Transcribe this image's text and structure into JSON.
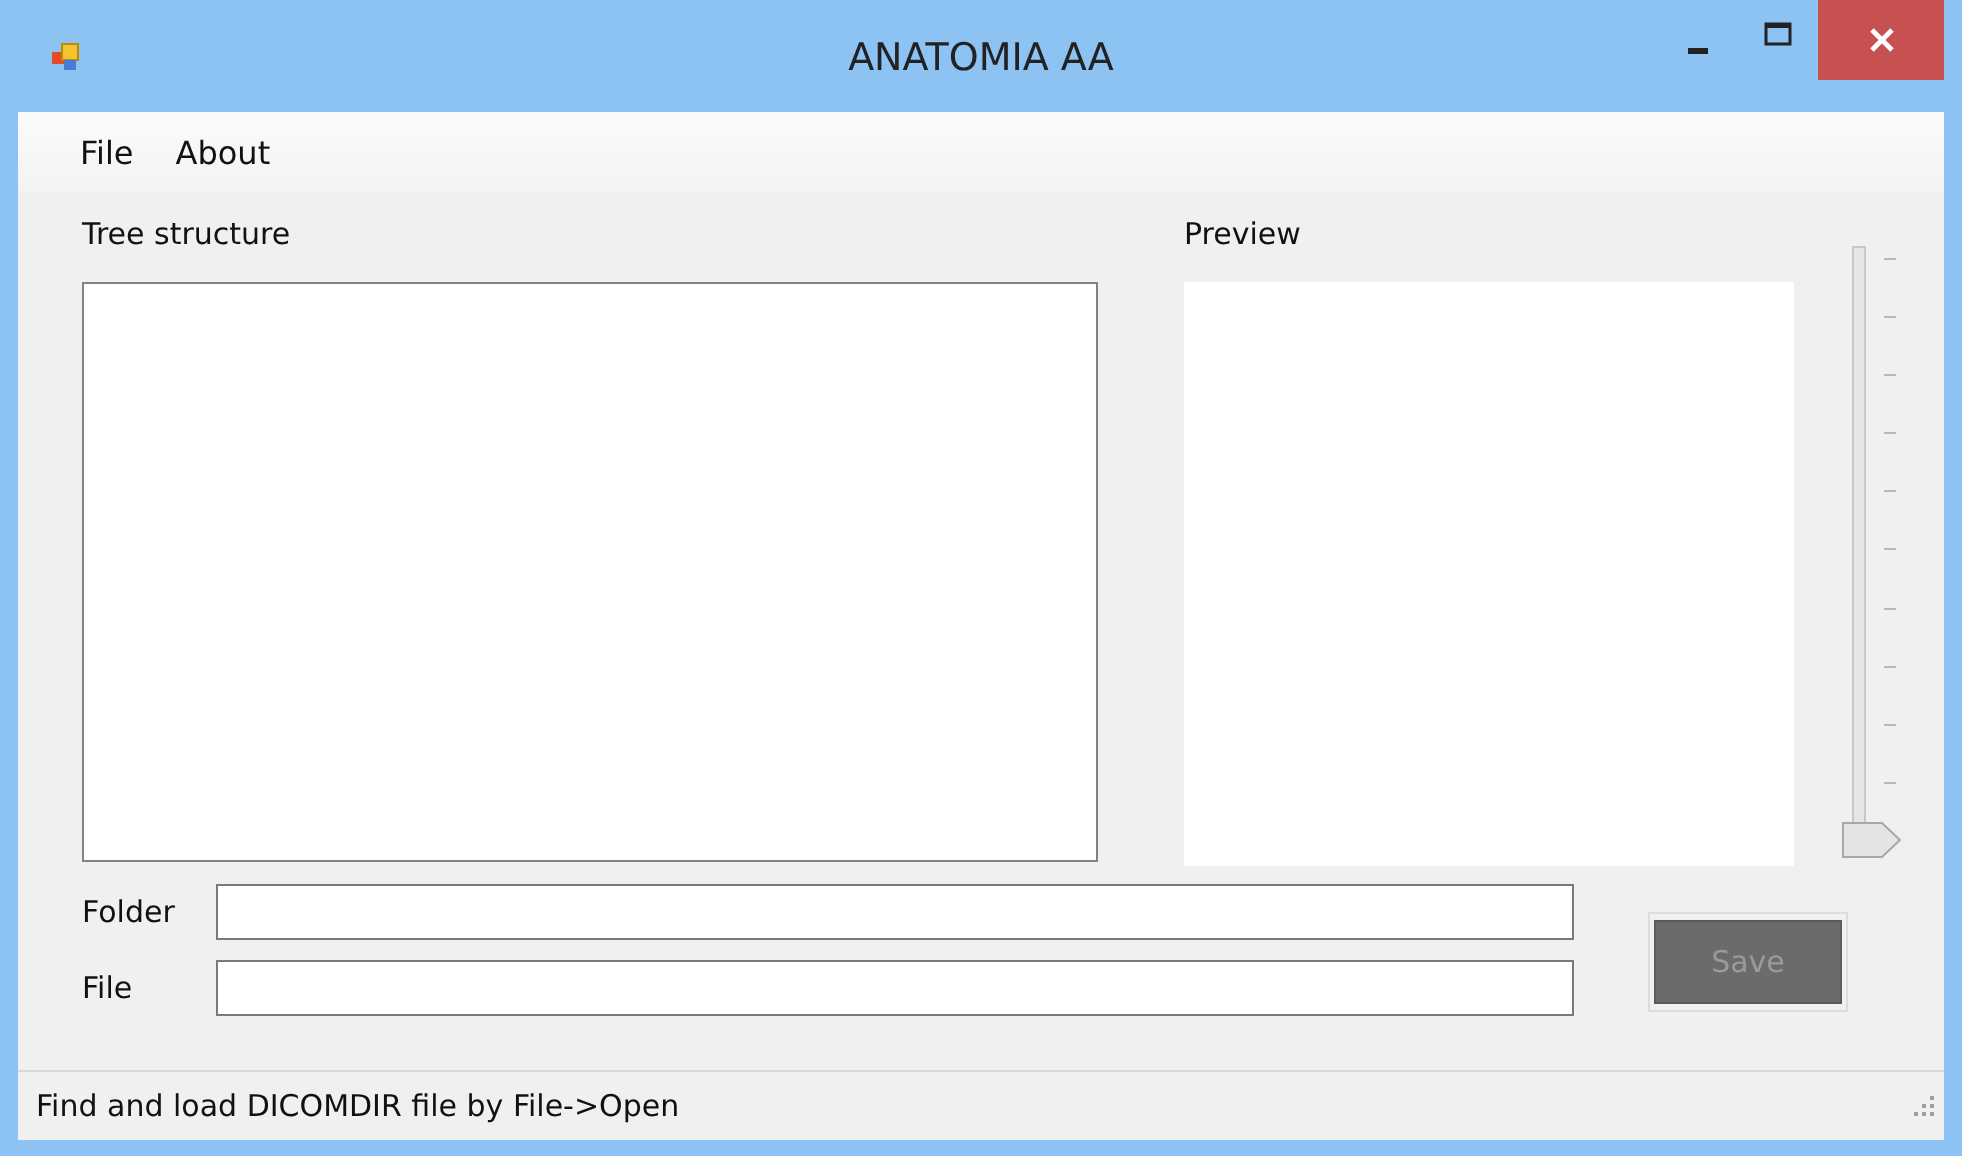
{
  "window": {
    "title": "ANATOMIA AA"
  },
  "menu": [
    {
      "label": "File"
    },
    {
      "label": "About"
    }
  ],
  "tree": {
    "label": "Tree structure"
  },
  "preview": {
    "label": "Preview"
  },
  "slider": {
    "level": 0
  },
  "fields": [
    {
      "label": "Folder"
    },
    {
      "label": "File"
    }
  ],
  "save_button": {
    "label": "Save",
    "disabled": true
  },
  "status_bar": {
    "text": "Find and load DICOMDIR file by File->Open"
  }
}
